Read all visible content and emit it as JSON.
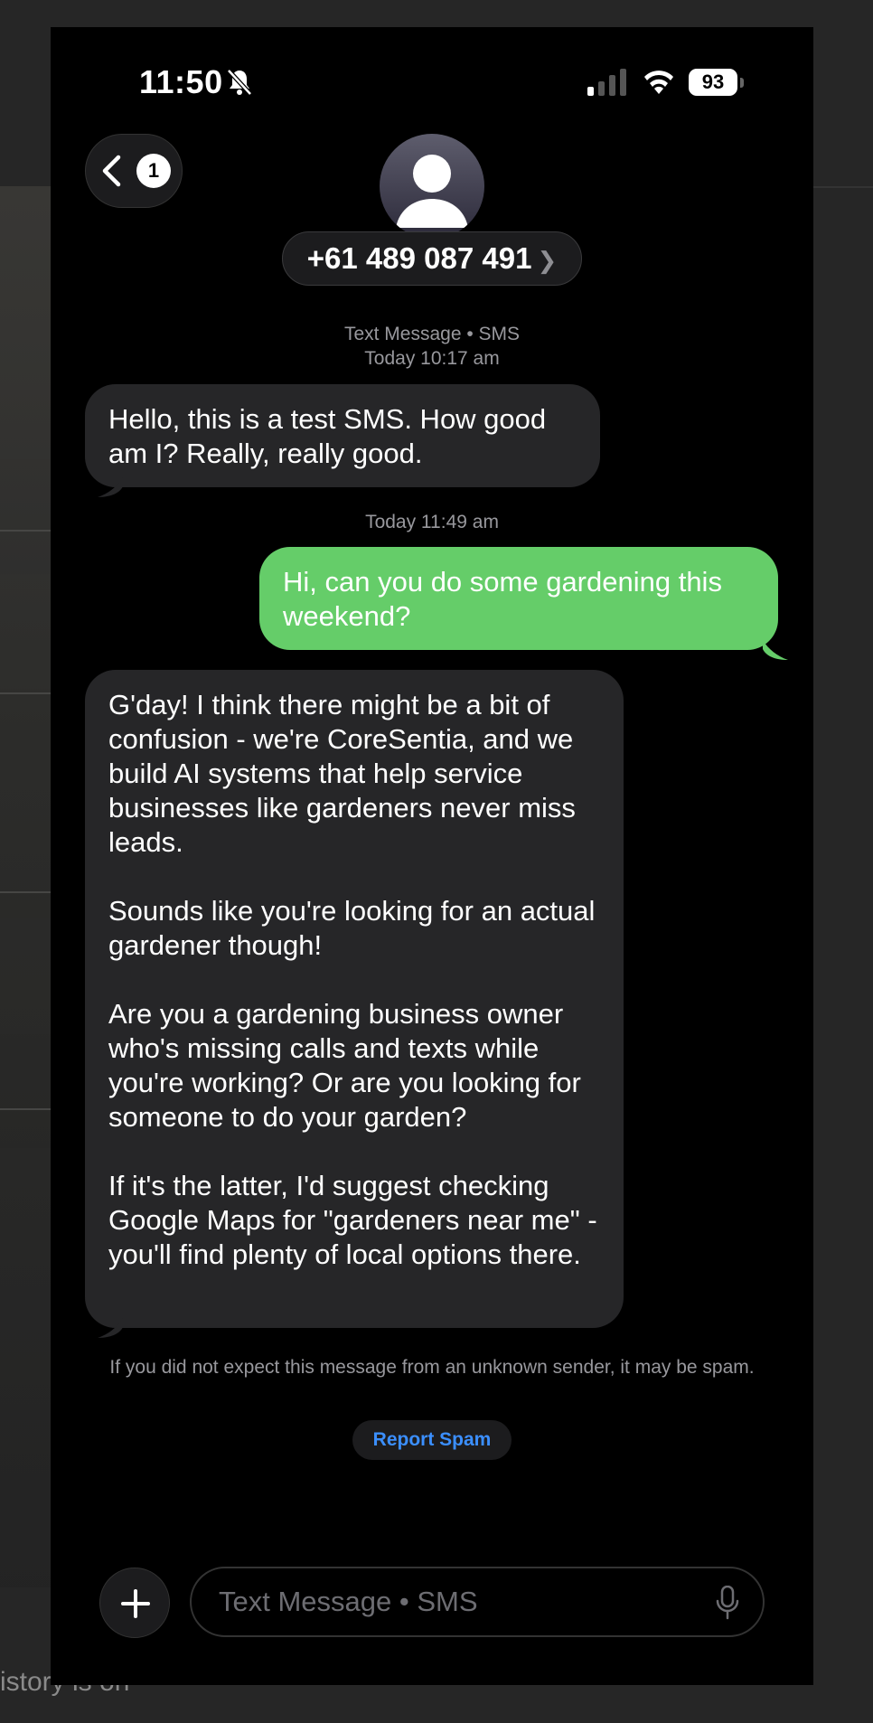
{
  "status_bar": {
    "time": "11:50",
    "battery": "93"
  },
  "header": {
    "back_count": "1",
    "contact": "+61 489 087 491",
    "contact_arrow": "❯"
  },
  "conversation": {
    "first_service": "Text Message • SMS",
    "first_timestamp": "Today 10:17 am",
    "messages": [
      {
        "direction": "in",
        "text": "Hello, this is a test SMS. How good am I? Really, really good."
      },
      {
        "timestamp": "Today 11:49 am"
      },
      {
        "direction": "out",
        "text": "Hi, can you do some gardening this weekend?"
      },
      {
        "direction": "in",
        "text": "G'day! I think there might be a bit of confusion - we're CoreSentia, and we build AI systems that help service businesses like gardeners never miss leads.\n\nSounds like you're looking for an actual gardener though!\n\nAre you a gardening business owner who's missing calls and texts while you're working? Or are you looking for someone to do your garden?\n\nIf it's the latter, I'd suggest checking Google Maps for \"gardeners near me\" - you'll find plenty of local options there."
      }
    ]
  },
  "spam": {
    "notice": "If you did not expect this message from an unknown sender, it may be spam.",
    "report_label": "Report Spam"
  },
  "composer": {
    "placeholder": "Text Message • SMS"
  },
  "background": {
    "footer_text": "istory is on"
  },
  "colors": {
    "outgoing_bubble": "#65cd69",
    "incoming_bubble": "#262628",
    "link_blue": "#3b8fff"
  },
  "icons": [
    "bell-slash-icon",
    "signal-icon",
    "wifi-icon",
    "battery-icon",
    "chevron-left-icon",
    "person-icon",
    "plus-icon",
    "microphone-icon"
  ]
}
